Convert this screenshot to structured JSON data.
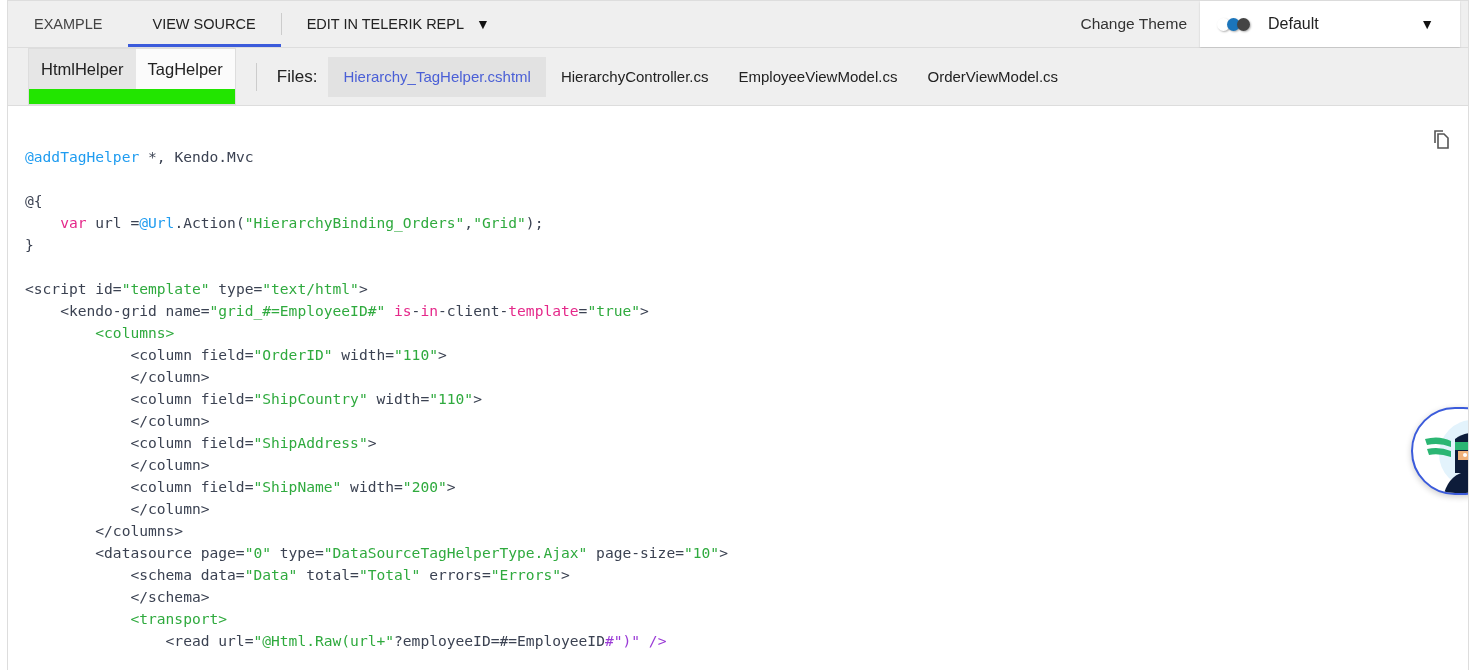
{
  "top_tabs": [
    {
      "label": "EXAMPLE",
      "selected": false
    },
    {
      "label": "VIEW SOURCE",
      "selected": true
    }
  ],
  "repl_menu": {
    "label": "EDIT IN TELERIK REPL",
    "caret": "▼"
  },
  "theme": {
    "label": "Change Theme",
    "value": "Default",
    "caret": "▼",
    "swatches": [
      {
        "color": "#ffffff"
      },
      {
        "color": "#1b75bb"
      },
      {
        "color": "#444444"
      }
    ]
  },
  "helper_toggle": [
    {
      "label": "HtmlHelper",
      "selected": false
    },
    {
      "label": "TagHelper",
      "selected": true
    }
  ],
  "files_label": "Files:",
  "files": [
    {
      "label": "Hierarchy_TagHelper.cshtml",
      "selected": true
    },
    {
      "label": "HierarchyController.cs",
      "selected": false
    },
    {
      "label": "EmployeeViewModel.cs",
      "selected": false
    },
    {
      "label": "OrderViewModel.cs",
      "selected": false
    }
  ],
  "code_blocks": [
    {
      "lines": [
        [
          {
            "kind": "razor",
            "text": "@addTagHelper"
          },
          {
            "kind": "plain",
            "text": " *, Kendo.Mvc"
          }
        ]
      ]
    },
    {
      "lines": [
        [
          {
            "kind": "plain",
            "text": "@{"
          }
        ],
        [
          {
            "kind": "keyword",
            "text": "    var"
          },
          {
            "kind": "plain",
            "text": " url ="
          },
          {
            "kind": "razor",
            "text": "@Url"
          },
          {
            "kind": "plain",
            "text": ".Action("
          },
          {
            "kind": "string",
            "text": "\"HierarchyBinding_Orders\""
          },
          {
            "kind": "plain",
            "text": ","
          },
          {
            "kind": "string",
            "text": "\"Grid\""
          },
          {
            "kind": "plain",
            "text": ");"
          }
        ],
        [
          {
            "kind": "plain",
            "text": "}"
          }
        ]
      ]
    },
    {
      "lines": [
        [
          {
            "kind": "plain",
            "text": "<script id="
          },
          {
            "kind": "string",
            "text": "\"template\""
          },
          {
            "kind": "plain",
            "text": " type="
          },
          {
            "kind": "string",
            "text": "\"text/html\""
          },
          {
            "kind": "plain",
            "text": ">"
          }
        ],
        [
          {
            "kind": "plain",
            "text": "    <kendo-grid name="
          },
          {
            "kind": "string",
            "text": "\"grid_#=EmployeeID#\" "
          },
          {
            "kind": "keyword",
            "text": "is"
          },
          {
            "kind": "plain",
            "text": "-"
          },
          {
            "kind": "keyword",
            "text": "in"
          },
          {
            "kind": "plain",
            "text": "-client-"
          },
          {
            "kind": "keyword",
            "text": "template"
          },
          {
            "kind": "plain",
            "text": "="
          },
          {
            "kind": "string",
            "text": "\"true\""
          },
          {
            "kind": "plain",
            "text": ">"
          }
        ],
        [
          {
            "kind": "string",
            "text": "        <columns>"
          }
        ],
        [
          {
            "kind": "plain",
            "text": "            <column field="
          },
          {
            "kind": "string",
            "text": "\"OrderID\""
          },
          {
            "kind": "plain",
            "text": " width="
          },
          {
            "kind": "string",
            "text": "\"110\""
          },
          {
            "kind": "plain",
            "text": ">"
          }
        ],
        [
          {
            "kind": "plain",
            "text": "            </column>"
          }
        ],
        [
          {
            "kind": "plain",
            "text": "            <column field="
          },
          {
            "kind": "string",
            "text": "\"ShipCountry\""
          },
          {
            "kind": "plain",
            "text": " width="
          },
          {
            "kind": "string",
            "text": "\"110\""
          },
          {
            "kind": "plain",
            "text": ">"
          }
        ],
        [
          {
            "kind": "plain",
            "text": "            </column>"
          }
        ],
        [
          {
            "kind": "plain",
            "text": "            <column field="
          },
          {
            "kind": "string",
            "text": "\"ShipAddress\""
          },
          {
            "kind": "plain",
            "text": ">"
          }
        ],
        [
          {
            "kind": "plain",
            "text": "            </column>"
          }
        ],
        [
          {
            "kind": "plain",
            "text": "            <column field="
          },
          {
            "kind": "string",
            "text": "\"ShipName\""
          },
          {
            "kind": "plain",
            "text": " width="
          },
          {
            "kind": "string",
            "text": "\"200\""
          },
          {
            "kind": "plain",
            "text": ">"
          }
        ],
        [
          {
            "kind": "plain",
            "text": "            </column>"
          }
        ],
        [
          {
            "kind": "plain",
            "text": "        </columns>"
          }
        ],
        [
          {
            "kind": "plain",
            "text": "        <datasource page="
          },
          {
            "kind": "string",
            "text": "\"0\""
          },
          {
            "kind": "plain",
            "text": " type="
          },
          {
            "kind": "string",
            "text": "\"DataSourceTagHelperType.Ajax\""
          },
          {
            "kind": "plain",
            "text": " page-size="
          },
          {
            "kind": "string",
            "text": "\"10\""
          },
          {
            "kind": "plain",
            "text": ">"
          }
        ],
        [
          {
            "kind": "plain",
            "text": "            <schema data="
          },
          {
            "kind": "string",
            "text": "\"Data\""
          },
          {
            "kind": "plain",
            "text": " total="
          },
          {
            "kind": "string",
            "text": "\"Total\""
          },
          {
            "kind": "plain",
            "text": " errors="
          },
          {
            "kind": "string",
            "text": "\"Errors\""
          },
          {
            "kind": "plain",
            "text": ">"
          }
        ],
        [
          {
            "kind": "plain",
            "text": "            </schema>"
          }
        ],
        [
          {
            "kind": "string",
            "text": "            <transport>"
          }
        ],
        [
          {
            "kind": "plain",
            "text": "                <read url="
          },
          {
            "kind": "string",
            "text": "\"@Html.Raw(url+\""
          },
          {
            "kind": "plain",
            "text": "?employeeID=#=EmployeeID"
          },
          {
            "kind": "purple",
            "text": "#\")\" />"
          }
        ]
      ]
    }
  ]
}
